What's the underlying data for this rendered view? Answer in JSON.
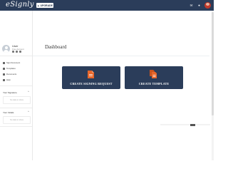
{
  "app": {
    "logo_text": "eSignly"
  },
  "topbar": {
    "upgrade_label": "UPGRADE"
  },
  "user": {
    "name": "User",
    "role": "Free Account"
  },
  "sidebar": {
    "items": [
      {
        "label": "Sign Document",
        "icon": "pen-icon"
      },
      {
        "label": "Templates",
        "icon": "template-icon"
      },
      {
        "label": "Documents",
        "icon": "folder-icon"
      },
      {
        "label": "Help",
        "icon": "help-icon"
      }
    ],
    "panels": [
      {
        "title": "Your Signature",
        "empty": "No data to show"
      },
      {
        "title": "Your Initials",
        "empty": "No data to show"
      }
    ]
  },
  "main": {
    "title": "Dashboard",
    "actions": [
      {
        "label": "CREATE SIGNING REQUEST",
        "icon": "document-icon"
      },
      {
        "label": "CREATE TEMPLATE",
        "icon": "documents-icon"
      }
    ]
  },
  "colors": {
    "primary": "#2b3d5a",
    "accent": "#e8672b"
  }
}
